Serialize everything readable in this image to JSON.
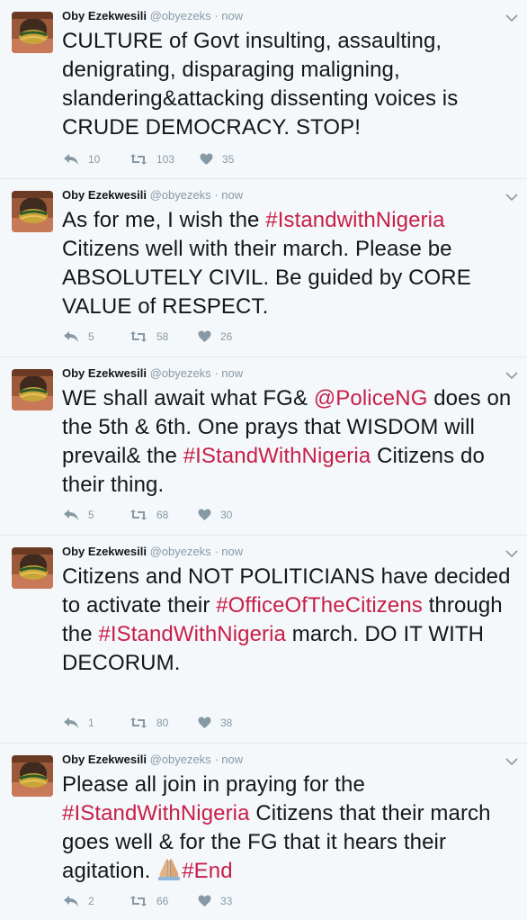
{
  "colors": {
    "background": "#f5f8fa",
    "text": "#14171a",
    "muted": "#8899a6",
    "hashtag": "#c71e4a",
    "divider": "#e1e8ed"
  },
  "tweets": [
    {
      "author_name": "Oby Ezekwesili",
      "handle": "@obyezeks",
      "time": "now",
      "segments": [
        {
          "type": "text",
          "text": "CULTURE of Govt insulting, assaulting, denigrating, disparaging maligning, slandering&attacking dissenting voices is CRUDE DEMOCRACY. STOP!"
        }
      ],
      "replies": "10",
      "retweets": "103",
      "likes": "35"
    },
    {
      "author_name": "Oby Ezekwesili",
      "handle": "@obyezeks",
      "time": "now",
      "segments": [
        {
          "type": "text",
          "text": "As for me, I wish the "
        },
        {
          "type": "hashtag",
          "text": "#IstandwithNigeria"
        },
        {
          "type": "text",
          "text": " Citizens well with their march. Please be ABSOLUTELY CIVIL. Be guided by CORE VALUE of RESPECT."
        }
      ],
      "replies": "5",
      "retweets": "58",
      "likes": "26"
    },
    {
      "author_name": "Oby Ezekwesili",
      "handle": "@obyezeks",
      "time": "now",
      "segments": [
        {
          "type": "text",
          "text": "WE shall await what FG& "
        },
        {
          "type": "mention",
          "text": "@PoliceNG"
        },
        {
          "type": "text",
          "text": " does on the 5th & 6th. One prays that WISDOM will prevail& the "
        },
        {
          "type": "hashtag",
          "text": "#IStandWithNigeria"
        },
        {
          "type": "text",
          "text": " Citizens do their thing."
        }
      ],
      "replies": "5",
      "retweets": "68",
      "likes": "30"
    },
    {
      "author_name": "Oby Ezekwesili",
      "handle": "@obyezeks",
      "time": "now",
      "segments": [
        {
          "type": "text",
          "text": "Citizens and NOT POLITICIANS have decided to activate their "
        },
        {
          "type": "hashtag",
          "text": "#OfficeOfTheCitizens"
        },
        {
          "type": "text",
          "text": " through the "
        },
        {
          "type": "hashtag",
          "text": "#IStandWithNigeria"
        },
        {
          "type": "text",
          "text": " march. DO IT WITH DECORUM."
        }
      ],
      "replies": "1",
      "retweets": "80",
      "likes": "38"
    },
    {
      "author_name": "Oby Ezekwesili",
      "handle": "@obyezeks",
      "time": "now",
      "segments": [
        {
          "type": "text",
          "text": "Please all join in praying for the "
        },
        {
          "type": "hashtag",
          "text": "#IStandWithNigeria"
        },
        {
          "type": "text",
          "text": " Citizens that their march goes well & for the FG that it hears their agitation. "
        },
        {
          "type": "emoji",
          "icon": "folded-hands-icon"
        },
        {
          "type": "hashtag",
          "text": "#End"
        }
      ],
      "replies": "2",
      "retweets": "66",
      "likes": "33"
    }
  ]
}
